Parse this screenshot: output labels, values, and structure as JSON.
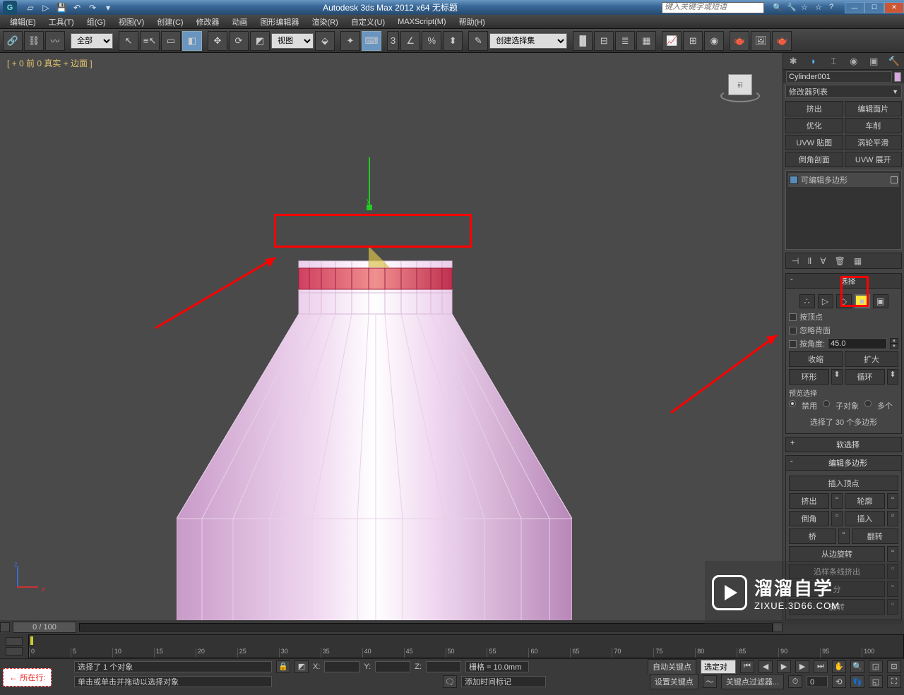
{
  "title": "Autodesk 3ds Max  2012 x64     无标题",
  "searchPlaceholder": "键入关键字或短语",
  "menu": [
    "编辑(E)",
    "工具(T)",
    "组(G)",
    "视图(V)",
    "创建(C)",
    "修改器",
    "动画",
    "图形编辑器",
    "渲染(R)",
    "自定义(U)",
    "MAXScript(M)",
    "帮助(H)"
  ],
  "filterSel": "全部",
  "viewSel": "视图",
  "namedSel": "创建选择集",
  "viewportLabel": "[ + 0 前 0 真实 + 边面 ]",
  "viewCubeFace": "前",
  "objectName": "Cylinder001",
  "modifierList": "修改器列表",
  "modBtns": [
    "挤出",
    "编辑面片",
    "优化",
    "车削",
    "UVW 贴图",
    "涡轮平滑",
    "倒角剖面",
    "UVW 展开"
  ],
  "stackItem": "可编辑多边形",
  "rollouts": {
    "select": {
      "title": "选择",
      "byVertex": "按顶点",
      "ignoreBack": "忽略背面",
      "byAngle": "按角度:",
      "angle": "45.0",
      "shrink": "收缩",
      "grow": "扩大",
      "ring": "环形",
      "loop": "循环",
      "preview": "预览选择",
      "r1": "禁用",
      "r2": "子对象",
      "r3": "多个",
      "count": "选择了 30 个多边形"
    },
    "soft": {
      "title": "软选择"
    },
    "editPoly": {
      "title": "编辑多边形",
      "insVert": "插入顶点",
      "extrude": "挤出",
      "outline": "轮廓",
      "bevel": "倒角",
      "inset": "插入",
      "bridge": "桥",
      "flip": "翻转",
      "hinge": "从边旋转",
      "extAlong": "沿样条线挤出",
      "split": "分",
      "rotate": "旋转"
    }
  },
  "timeHandle": "0 / 100",
  "ticks": [
    "0",
    "5",
    "10",
    "15",
    "20",
    "25",
    "30",
    "35",
    "40",
    "45",
    "50",
    "55",
    "60",
    "65",
    "70",
    "75",
    "80",
    "85",
    "90",
    "95",
    "100"
  ],
  "statusSel": "选择了 1 个对象",
  "prompt": "单击或单击并拖动以选择对象",
  "coordX": "X:",
  "coordY": "Y:",
  "coordZ": "Z:",
  "grid": "栅格 = 10.0mm",
  "autoKey": "自动关键点",
  "selSet": "选定对",
  "setKey": "设置关键点",
  "keyFilter": "关键点过滤器...",
  "addTag": "添加时间标记",
  "dragMsg": "",
  "nowAt": "所在行:",
  "wm1": "溜溜自学",
  "wm2": "ZIXUE.3D66.COM"
}
